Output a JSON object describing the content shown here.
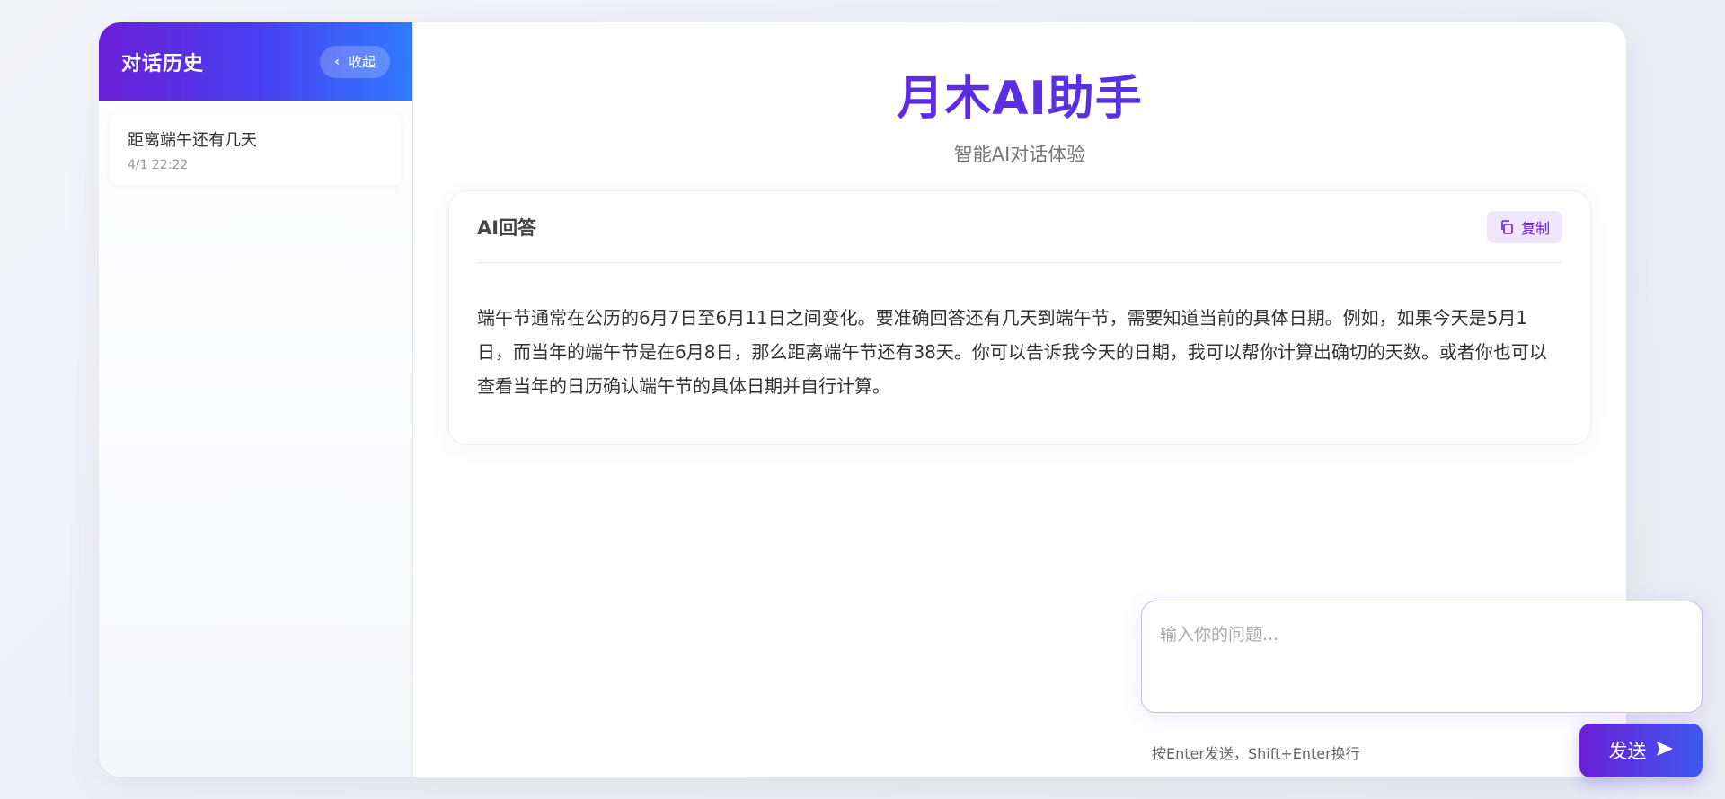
{
  "sidebar": {
    "title": "对话历史",
    "collapse_label": "收起",
    "items": [
      {
        "title": "距离端午还有几天",
        "time": "4/1 22:22"
      }
    ]
  },
  "main": {
    "title": "月木AI助手",
    "subtitle": "智能AI对话体验",
    "answer": {
      "label": "AI回答",
      "copy_label": "复制",
      "text": "端午节通常在公历的6月7日至6月11日之间变化。要准确回答还有几天到端午节，需要知道当前的具体日期。例如，如果今天是5月1日，而当年的端午节是在6月8日，那么距离端午节还有38天。你可以告诉我今天的日期，我可以帮你计算出确切的天数。或者你也可以查看当年的日历确认端午节的具体日期并自行计算。"
    }
  },
  "composer": {
    "placeholder": "输入你的问题...",
    "value": "",
    "hint": "按Enter发送，Shift+Enter换行",
    "send_label": "发送"
  },
  "colors": {
    "accent": "#6a1fd6",
    "accent_blue": "#2f7bff"
  },
  "icons": {
    "collapse": "chevron-left-icon",
    "copy": "copy-icon",
    "send": "send-icon"
  }
}
